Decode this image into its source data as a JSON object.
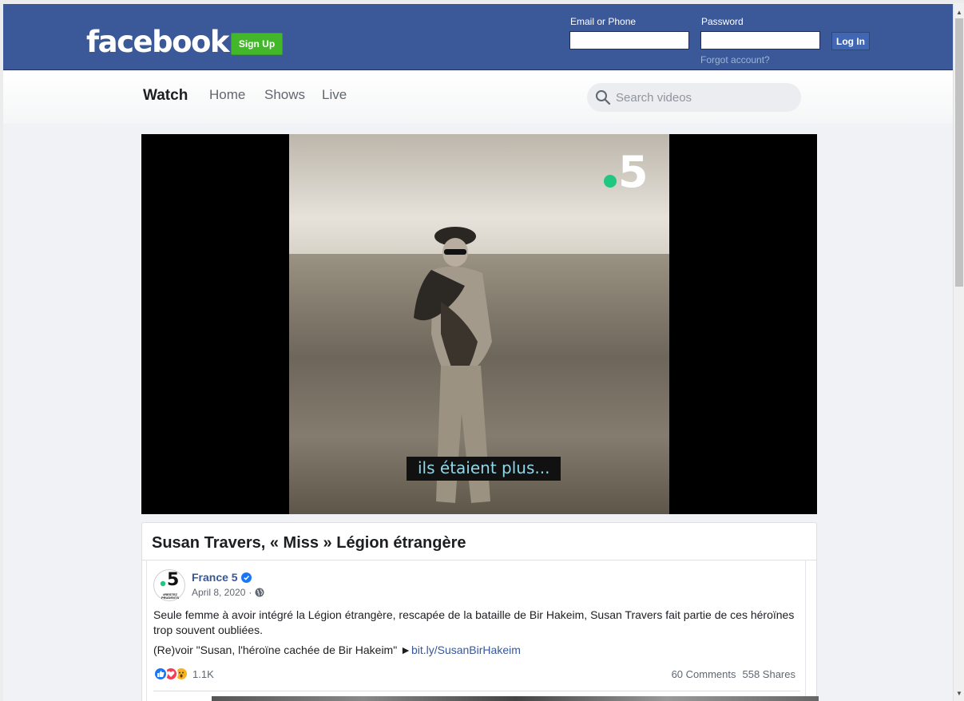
{
  "header": {
    "logo": "facebook",
    "signup_label": "Sign Up",
    "email_label": "Email or Phone",
    "password_label": "Password",
    "login_label": "Log In",
    "forgot_label": "Forgot account?",
    "brand_color": "#3b5998"
  },
  "watchnav": {
    "title": "Watch",
    "items": [
      {
        "label": "Home"
      },
      {
        "label": "Shows"
      },
      {
        "label": "Live"
      }
    ],
    "search_placeholder": "Search videos"
  },
  "video": {
    "channel_logo_text": "5",
    "subtitle": "ils étaient plus..."
  },
  "post": {
    "title": "Susan Travers, « Miss » Légion étrangère",
    "page_name": "France 5",
    "avatar_text": "5",
    "avatar_caption": "#RESTEZ PRUDENTS",
    "date": "April 8, 2020",
    "date_separator": "·",
    "text": "Seule femme à avoir intégré la Légion étrangère, rescapée de la bataille de Bir Hakeim, Susan Travers fait partie de ces héroïnes trop souvent oubliées.",
    "link_prefix": "(Re)voir \"Susan, l'héroïne cachée de Bir Hakeim\" ►",
    "link_text": "bit.ly/SusanBirHakeim",
    "reaction_count": "1.1K",
    "comments": "60 Comments",
    "shares": "558 Shares"
  }
}
